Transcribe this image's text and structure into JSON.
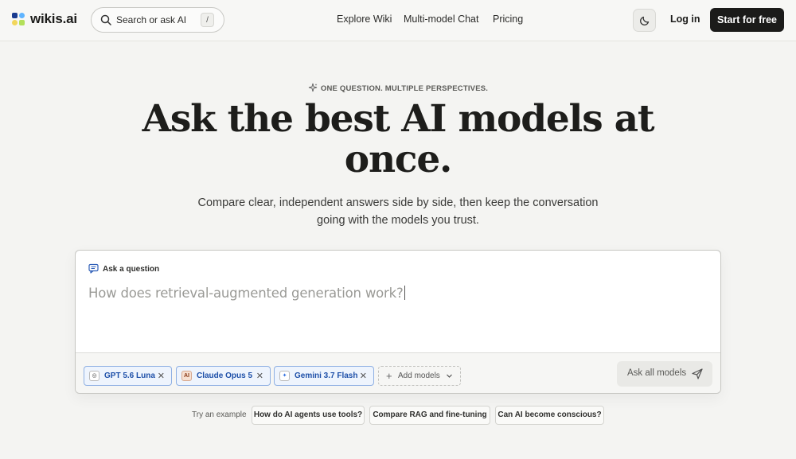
{
  "header": {
    "brand": "wikis.ai",
    "search": {
      "placeholder": "Search or ask AI",
      "shortcut": "/"
    },
    "nav": [
      "Explore Wiki",
      "Multi-model Chat",
      "Pricing"
    ],
    "theme_icon": "moon-icon",
    "login": "Log in",
    "cta": "Start for free"
  },
  "hero": {
    "eyebrow": "ONE QUESTION. MULTIPLE PERSPECTIVES.",
    "headline_line1": "Ask the best AI models at",
    "headline_line2": "once.",
    "subhead_line1": "Compare clear, independent answers side by side, then keep the conversation",
    "subhead_line2": "going with the models you trust."
  },
  "ask": {
    "label": "Ask a question",
    "question_placeholder": "How does retrieval-augmented generation work?",
    "models": [
      {
        "name": "GPT 5.6 Luna",
        "icon": "openai-icon"
      },
      {
        "name": "Claude Opus 5",
        "icon": "anthropic-icon"
      },
      {
        "name": "Gemini 3.7 Flash",
        "icon": "gemini-icon"
      }
    ],
    "add_models": "Add models",
    "submit": "Ask all models"
  },
  "examples": {
    "label": "Try an example",
    "items": [
      "How do AI agents use tools?",
      "Compare RAG and fine-tuning",
      "Can AI become conscious?"
    ]
  },
  "colors": {
    "background": "#f4f4f2",
    "cta_bg": "#1b1b1a",
    "chip_border": "#8fb0e3",
    "chip_text": "#1d4fa8"
  }
}
